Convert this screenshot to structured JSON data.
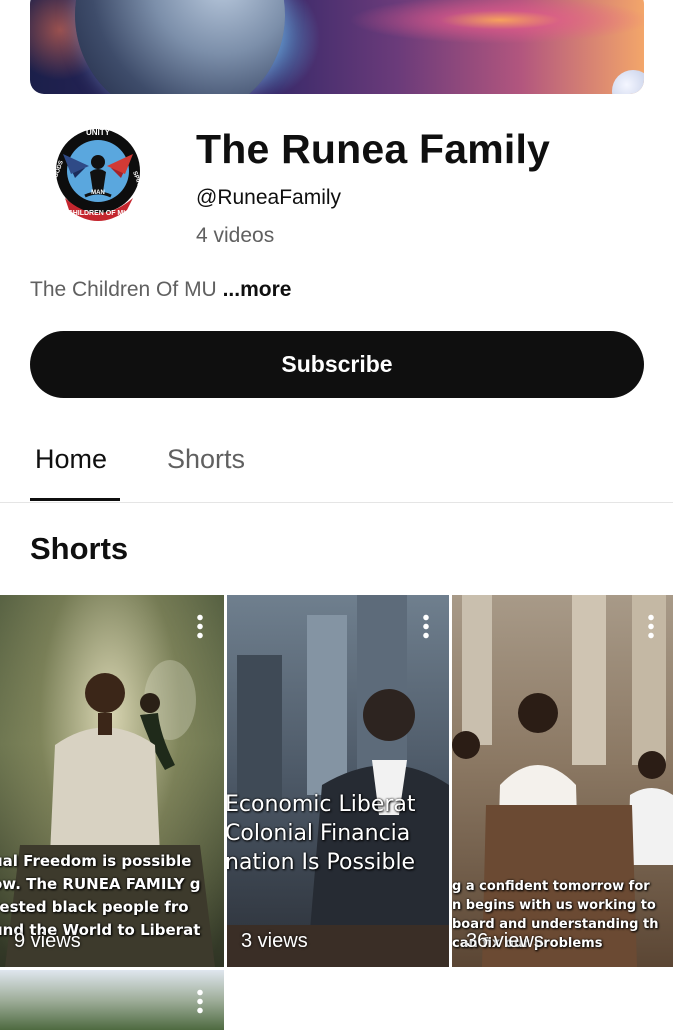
{
  "channel": {
    "name": "The Runea Family",
    "handle": "@RuneaFamily",
    "video_count": "4 videos",
    "description": "The Children Of MU",
    "more_label": "...more",
    "avatar_text": [
      "UNITY",
      "GODS",
      "MAN",
      "SPIRITS",
      "CHILDREN OF MU"
    ]
  },
  "subscribe_label": "Subscribe",
  "tabs": [
    {
      "label": "Home",
      "active": true
    },
    {
      "label": "Shorts",
      "active": false
    }
  ],
  "section_title": "Shorts",
  "shorts": [
    {
      "overlay_lines": [
        "ual Freedom is possible",
        "ow. The RUNEA FAMILY g",
        "rested black people fro",
        "und the World to Liberat"
      ],
      "views": "9 views"
    },
    {
      "overlay_lines": [
        "Economic Liberat",
        "Colonial Financia",
        "nation Is Possible"
      ],
      "views": "3 views"
    },
    {
      "overlay_lines": [
        "g a confident tomorrow for",
        "n begins with us working to",
        "board and understanding th",
        "can fix our problems"
      ],
      "views": "36 views"
    }
  ],
  "colors": {
    "accent": "#0f0f0f",
    "secondary_text": "#606060",
    "subscribe_text": "#ffffff"
  }
}
